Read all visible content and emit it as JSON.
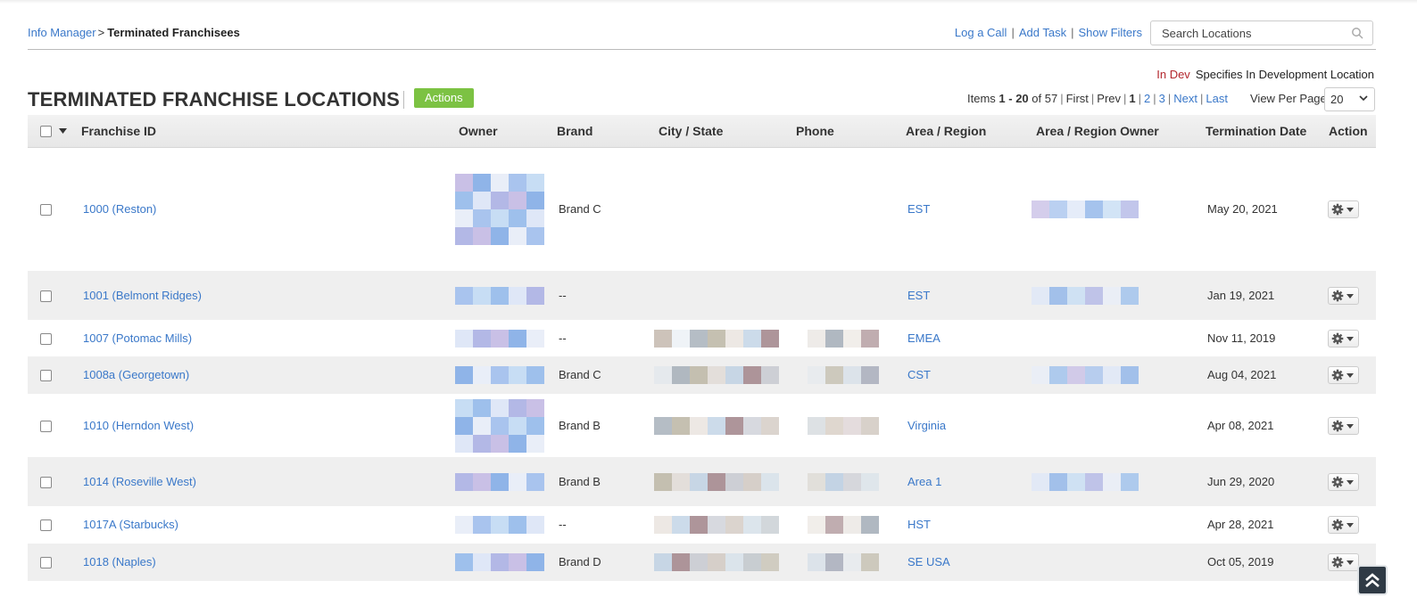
{
  "breadcrumb": {
    "parent": "Info Manager",
    "separator": ">",
    "current": "Terminated Franchisees"
  },
  "header_links": {
    "log_call": "Log a Call",
    "add_task": "Add Task",
    "show_filters": "Show Filters",
    "pipe": "|"
  },
  "search": {
    "placeholder": "Search Locations",
    "icon": "search-icon"
  },
  "legend": {
    "tag": "In Dev",
    "description": "Specifies In Development Location"
  },
  "page_title": "TERMINATED FRANCHISE LOCATIONS",
  "actions_label": "Actions",
  "pager": {
    "items_prefix": "Items",
    "range": "1 - 20",
    "of_text": "of 57",
    "first": "First",
    "prev": "Prev",
    "current": "1",
    "page2": "2",
    "page3": "3",
    "next": "Next",
    "last": "Last"
  },
  "per_page": {
    "label": "View Per Page",
    "value": "20"
  },
  "columns": {
    "franchise_id": "Franchise ID",
    "owner": "Owner",
    "brand": "Brand",
    "city_state": "City /  State",
    "phone": "Phone",
    "area_region": "Area / Region",
    "area_region_owner": "Area / Region Owner",
    "termination_date": "Termination Date",
    "action": "Action"
  },
  "rows": [
    {
      "franchise_id": "1000 (Reston)",
      "brand": "Brand C",
      "area": "EST",
      "termination_date": "May 20, 2021"
    },
    {
      "franchise_id": "1001 (Belmont Ridges)",
      "brand": "--",
      "area": "EST",
      "termination_date": "Jan 19, 2021"
    },
    {
      "franchise_id": "1007 (Potomac Mills)",
      "brand": "--",
      "area": "EMEA",
      "termination_date": "Nov 11, 2019"
    },
    {
      "franchise_id": "1008a (Georgetown)",
      "brand": "Brand C",
      "area": "CST",
      "termination_date": "Aug 04, 2021"
    },
    {
      "franchise_id": "1010 (Herndon West)",
      "brand": "Brand B",
      "area": "Virginia",
      "termination_date": "Apr 08, 2021"
    },
    {
      "franchise_id": "1014 (Roseville West)",
      "brand": "Brand B",
      "area": "Area 1",
      "termination_date": "Jun 29, 2020"
    },
    {
      "franchise_id": "1017A (Starbucks)",
      "brand": "--",
      "area": "HST",
      "termination_date": "Apr 28, 2021"
    },
    {
      "franchise_id": "1018 (Naples)",
      "brand": "Brand D",
      "area": "SE USA",
      "termination_date": "Oct 05, 2019"
    }
  ],
  "icons": {
    "gear": "gear-icon",
    "caret": "caret-down-icon",
    "scroll_top": "double-chevron-up-icon"
  },
  "colors": {
    "link": "#3a78c9",
    "actions_button": "#7cc243",
    "in_dev": "#b3272d",
    "alt_row": "#efefef"
  }
}
